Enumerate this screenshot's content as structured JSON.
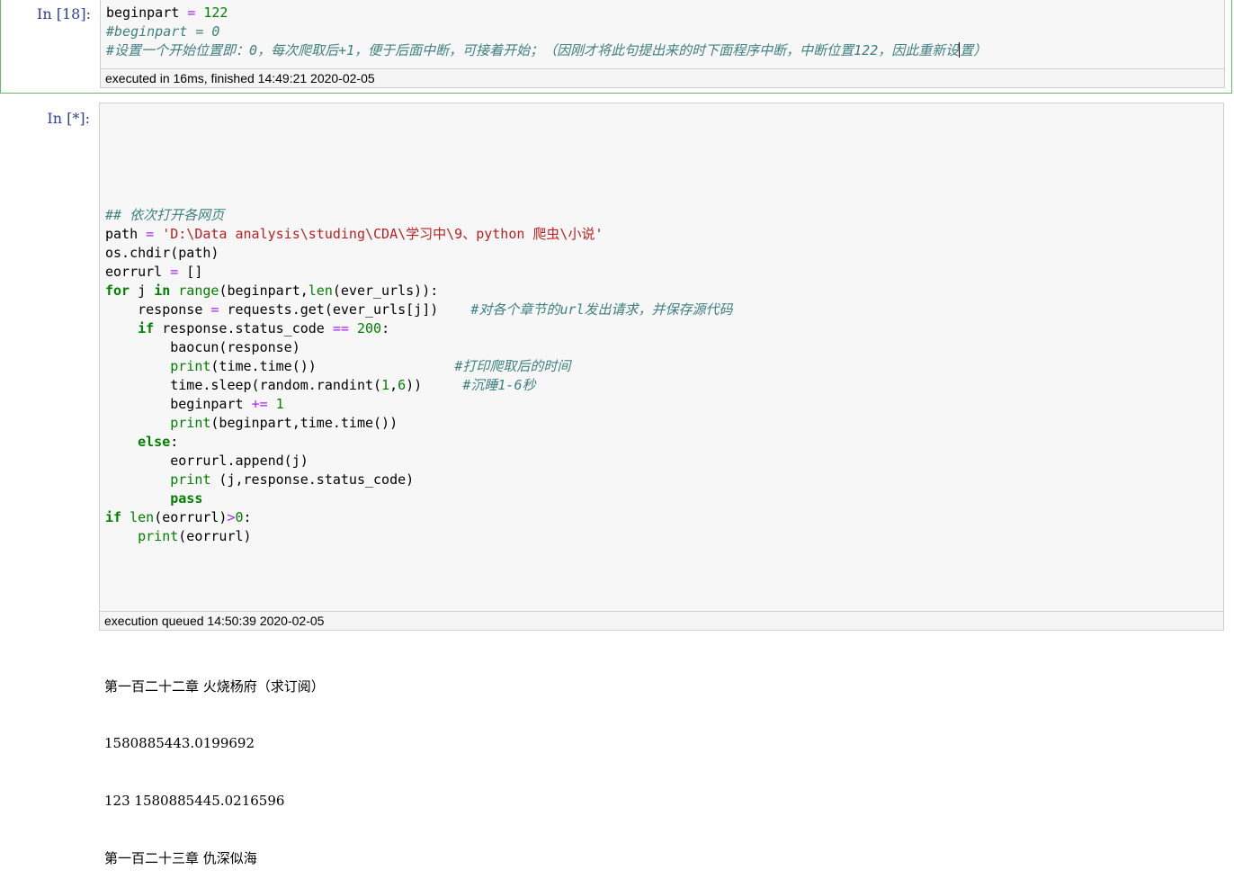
{
  "cell1": {
    "prompt": "In  [18]:",
    "code": [
      [
        {
          "t": "beginpart "
        },
        {
          "t": "=",
          "c": "op"
        },
        {
          "t": " "
        },
        {
          "t": "122",
          "c": "num"
        }
      ],
      [
        {
          "t": "#beginpart = 0",
          "c": "cm"
        }
      ],
      [
        {
          "t": "#设置一个开始位置即：0，每次爬取后+1，便于后面中断，可接着开始；（因刚才将此句提出来的时下面程序中断，中断位置122，因此重新设",
          "c": "cm"
        },
        {
          "cursor": true
        },
        {
          "t": "置）",
          "c": "cm"
        }
      ]
    ],
    "status": "executed in 16ms, finished 14:49:21 2020-02-05"
  },
  "cell2": {
    "prompt": "In  [*]:",
    "code": [
      [],
      [],
      [],
      [],
      [],
      [
        {
          "t": "## 依次打开各网页",
          "c": "cm"
        }
      ],
      [
        {
          "t": "path "
        },
        {
          "t": "=",
          "c": "op"
        },
        {
          "t": " "
        },
        {
          "t": "'D:\\Data analysis\\studing\\CDA\\学习中\\9、python 爬虫\\小说'",
          "c": "str"
        }
      ],
      [
        {
          "t": "os.chdir(path)"
        }
      ],
      [
        {
          "t": "eorrurl "
        },
        {
          "t": "=",
          "c": "op"
        },
        {
          "t": " []"
        }
      ],
      [
        {
          "t": "for",
          "c": "kw"
        },
        {
          "t": " j "
        },
        {
          "t": "in",
          "c": "kw"
        },
        {
          "t": " "
        },
        {
          "t": "range",
          "c": "bi"
        },
        {
          "t": "(beginpart,"
        },
        {
          "t": "len",
          "c": "bi"
        },
        {
          "t": "(ever_urls)):"
        }
      ],
      [
        {
          "t": "    response "
        },
        {
          "t": "=",
          "c": "op"
        },
        {
          "t": " requests.get(ever_urls[j])    "
        },
        {
          "t": "#对各个章节的url发出请求，并保存源代码",
          "c": "cm"
        }
      ],
      [
        {
          "t": "    "
        },
        {
          "t": "if",
          "c": "kw"
        },
        {
          "t": " response.status_code "
        },
        {
          "t": "==",
          "c": "op"
        },
        {
          "t": " "
        },
        {
          "t": "200",
          "c": "num"
        },
        {
          "t": ":"
        }
      ],
      [
        {
          "t": "        baocun(response)"
        }
      ],
      [
        {
          "t": "        "
        },
        {
          "t": "print",
          "c": "bi"
        },
        {
          "t": "(time.time())                 "
        },
        {
          "t": "#打印爬取后的时间",
          "c": "cm"
        }
      ],
      [
        {
          "t": "        time.sleep(random.randint("
        },
        {
          "t": "1",
          "c": "num"
        },
        {
          "t": ","
        },
        {
          "t": "6",
          "c": "num"
        },
        {
          "t": "))     "
        },
        {
          "t": "#沉睡1-6秒",
          "c": "cm"
        }
      ],
      [
        {
          "t": "        beginpart "
        },
        {
          "t": "+=",
          "c": "op"
        },
        {
          "t": " "
        },
        {
          "t": "1",
          "c": "num"
        }
      ],
      [
        {
          "t": "        "
        },
        {
          "t": "print",
          "c": "bi"
        },
        {
          "t": "(beginpart,time.time())"
        }
      ],
      [
        {
          "t": "    "
        },
        {
          "t": "else",
          "c": "kw"
        },
        {
          "t": ":"
        }
      ],
      [
        {
          "t": "        eorrurl.append(j)"
        }
      ],
      [
        {
          "t": "        "
        },
        {
          "t": "print",
          "c": "bi"
        },
        {
          "t": " (j,response.status_code)"
        }
      ],
      [
        {
          "t": "        "
        },
        {
          "t": "pass",
          "c": "kw"
        }
      ],
      [
        {
          "t": "if",
          "c": "kw"
        },
        {
          "t": " "
        },
        {
          "t": "len",
          "c": "bi"
        },
        {
          "t": "(eorrurl)"
        },
        {
          "t": ">",
          "c": "op"
        },
        {
          "t": "0",
          "c": "num"
        },
        {
          "t": ":"
        }
      ],
      [
        {
          "t": "    "
        },
        {
          "t": "print",
          "c": "bi"
        },
        {
          "t": "(eorrurl)"
        }
      ]
    ],
    "status": "execution queued 14:50:39 2020-02-05",
    "output": [
      "第一百二十二章 火烧杨府（求订阅）",
      "1580885443.0199692",
      "123 1580885445.0216596",
      "第一百二十三章 仇深似海"
    ]
  },
  "colors": {
    "comment": "#408080",
    "string": "#ba2121",
    "keyword": "#008000",
    "number": "#008000",
    "operator": "#aa22ff",
    "prompt": "#303f9f",
    "selected_border": "#66bb6a"
  }
}
